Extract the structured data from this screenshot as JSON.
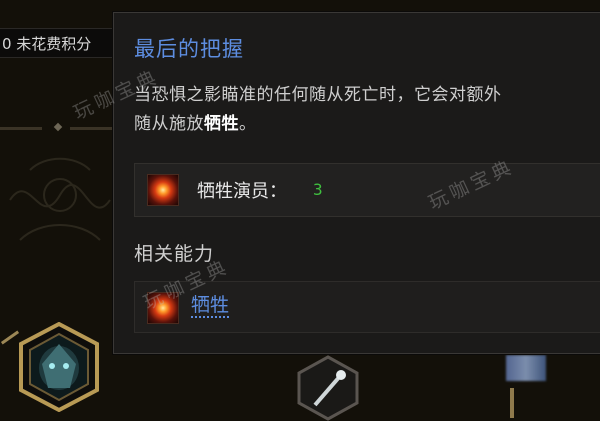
{
  "background": {
    "points_text": "0 未花费积分",
    "accent": "#9c8756"
  },
  "tooltip": {
    "title": "最后的把握",
    "desc_pre": "当恐惧之影瞄准的任何随从死亡时，它会对额外",
    "desc_line2_pre": "随从施放",
    "desc_keyword": "牺牲",
    "desc_line2_post": "。",
    "stat": {
      "icon": "sacrifice-icon",
      "label": "牺牲演员：",
      "value": "3"
    },
    "related_header": "相关能力",
    "ability": {
      "icon": "sacrifice-icon",
      "name": "牺牲"
    },
    "colors": {
      "title": "#5d8de0",
      "value": "#3fbf3f"
    }
  },
  "watermark": "玩咖宝典"
}
